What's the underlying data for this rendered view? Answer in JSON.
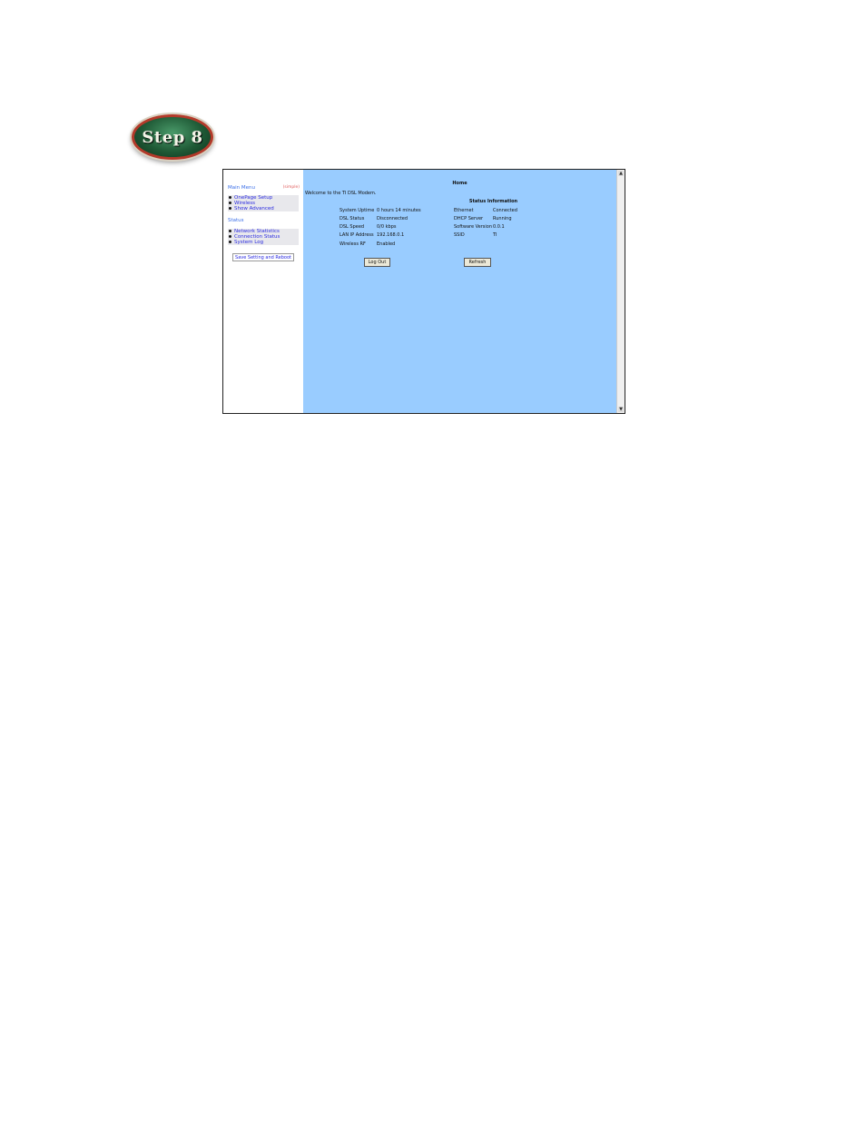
{
  "step_badge": "Step 8",
  "sidebar": {
    "main_menu": "Main Menu",
    "mode_link": "(simple)",
    "main_items": [
      "OnePage Setup",
      "Wireless",
      "Show Advanced"
    ],
    "status_header": "Status",
    "status_items": [
      "Network Statistics",
      "Connection Status",
      "System Log"
    ],
    "save_button": "Save Setting and Reboot"
  },
  "main": {
    "title": "Home",
    "welcome": "Welcome to the TI DSL Modem.",
    "status_title": "Status Information",
    "left_stats": [
      {
        "label": "System Uptime",
        "value": "0 hours 14 minutes"
      },
      {
        "label": "DSL Status",
        "value": "Disconnected"
      },
      {
        "label": "DSL Speed",
        "value": "0/0 kbps"
      },
      {
        "label": "LAN IP Address",
        "value": "192.168.0.1"
      },
      {
        "label": "Wireless RF",
        "value": "Enabled"
      }
    ],
    "right_stats": [
      {
        "label": "Ethernet",
        "value": "Connected"
      },
      {
        "label": "DHCP Server",
        "value": "Running"
      },
      {
        "label": "Software Version",
        "value": "0.0.1"
      },
      {
        "label": "SSID",
        "value": "TI"
      }
    ],
    "logout_button": "Log Out",
    "refresh_button": "Refresh"
  }
}
